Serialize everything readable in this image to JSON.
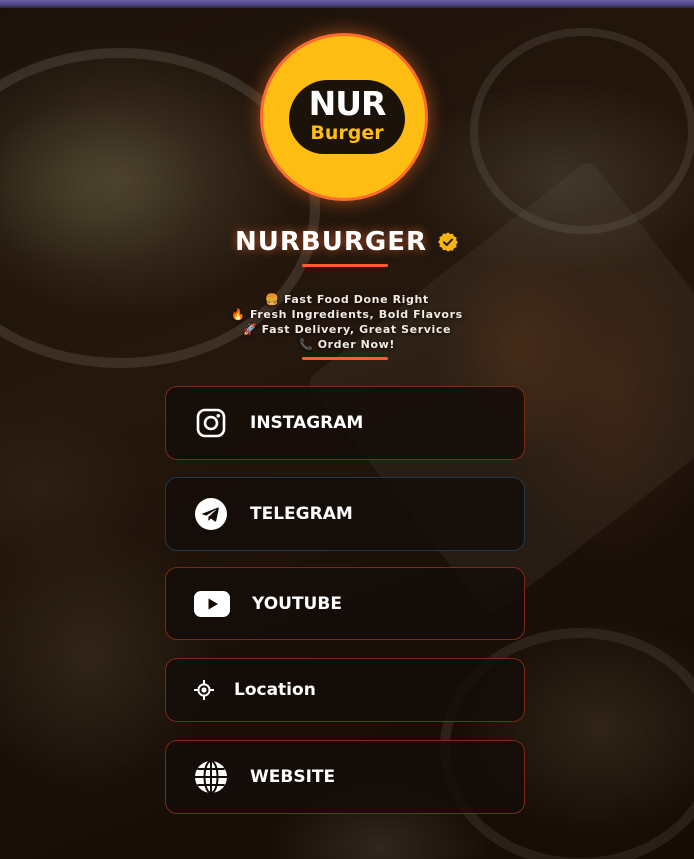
{
  "profile": {
    "logo_text_top": "NUR",
    "logo_text_bottom": "Burger",
    "name": "NURBURGER",
    "verified": true,
    "colors": {
      "logo_fill": "#fdbd12",
      "accent": "#ff5a2e",
      "verified_badge": "#f5b50f"
    }
  },
  "tagline": [
    "🍔 Fast Food Done Right",
    "🔥 Fresh Ingredients, Bold Flavors",
    "🚀 Fast Delivery, Great Service",
    "📞 Order Now!"
  ],
  "links": [
    {
      "label": "INSTAGRAM",
      "icon": "instagram-icon"
    },
    {
      "label": "TELEGRAM",
      "icon": "telegram-icon"
    },
    {
      "label": "YOUTUBE",
      "icon": "youtube-icon"
    },
    {
      "label": "Location",
      "icon": "location-crosshair-icon"
    },
    {
      "label": "WEBSITE",
      "icon": "globe-icon"
    }
  ]
}
